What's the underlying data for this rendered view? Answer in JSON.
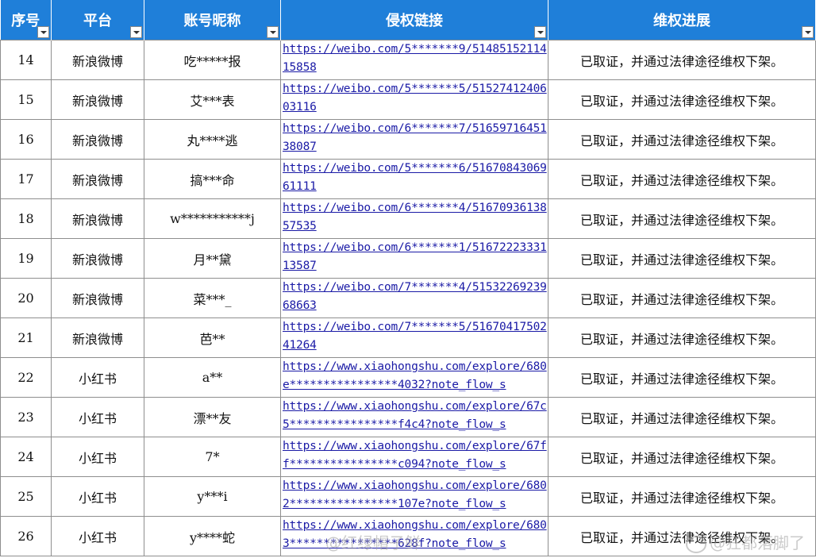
{
  "headers": [
    "序号",
    "平台",
    "账号昵称",
    "侵权链接",
    "维权进展"
  ],
  "rows": [
    {
      "no": "14",
      "platform": "新浪微博",
      "nick": "吃*****报",
      "link": "https://weibo.com/5*******9/5148515211415858",
      "status": "已取证，并通过法律途径维权下架。"
    },
    {
      "no": "15",
      "platform": "新浪微博",
      "nick": "艾***表",
      "link": "https://weibo.com/5*******5/5152741240603116",
      "status": "已取证，并通过法律途径维权下架。"
    },
    {
      "no": "16",
      "platform": "新浪微博",
      "nick": "丸****逃",
      "link": "https://weibo.com/6*******7/5165971645138087",
      "status": "已取证，并通过法律途径维权下架。"
    },
    {
      "no": "17",
      "platform": "新浪微博",
      "nick": "搞***命",
      "link": "https://weibo.com/5*******6/5167084306961111",
      "status": "已取证，并通过法律途径维权下架。"
    },
    {
      "no": "18",
      "platform": "新浪微博",
      "nick": "w***********j",
      "link": "https://weibo.com/6*******4/5167093613857535",
      "status": "已取证，并通过法律途径维权下架。"
    },
    {
      "no": "19",
      "platform": "新浪微博",
      "nick": "月**黛",
      "link": "https://weibo.com/6*******1/5167222333113587",
      "status": "已取证，并通过法律途径维权下架。"
    },
    {
      "no": "20",
      "platform": "新浪微博",
      "nick": "菜***_",
      "link": "https://weibo.com/7*******4/5153226923968663",
      "status": "已取证，并通过法律途径维权下架。"
    },
    {
      "no": "21",
      "platform": "新浪微博",
      "nick": "芭**",
      "link": "https://weibo.com/7*******5/5167041750241264",
      "status": "已取证，并通过法律途径维权下架。"
    },
    {
      "no": "22",
      "platform": "小红书",
      "nick": "a**",
      "link": "https://www.xiaohongshu.com/explore/680e****************4032?note_flow_s",
      "status": "已取证，并通过法律途径维权下架。"
    },
    {
      "no": "23",
      "platform": "小红书",
      "nick": "漂**友",
      "link": "https://www.xiaohongshu.com/explore/67c5****************f4c4?note_flow_s",
      "status": "已取证，并通过法律途径维权下架。"
    },
    {
      "no": "24",
      "platform": "小红书",
      "nick": "7*",
      "link": "https://www.xiaohongshu.com/explore/67ff****************c094?note_flow_s",
      "status": "已取证，并通过法律途径维权下架。"
    },
    {
      "no": "25",
      "platform": "小红书",
      "nick": "y***i",
      "link": "https://www.xiaohongshu.com/explore/6802****************107e?note_flow_s",
      "status": "已取证，并通过法律途径维权下架。"
    },
    {
      "no": "26",
      "platform": "小红书",
      "nick": "y****蛇",
      "link": "https://www.xiaohongshu.com/explore/6803****************628f?note_flow_s",
      "status": "已取证，并通过法律途径维权下架。"
    }
  ],
  "watermark_left": "@红绿帽子鲜",
  "watermark_right": "@狂都落脚了"
}
